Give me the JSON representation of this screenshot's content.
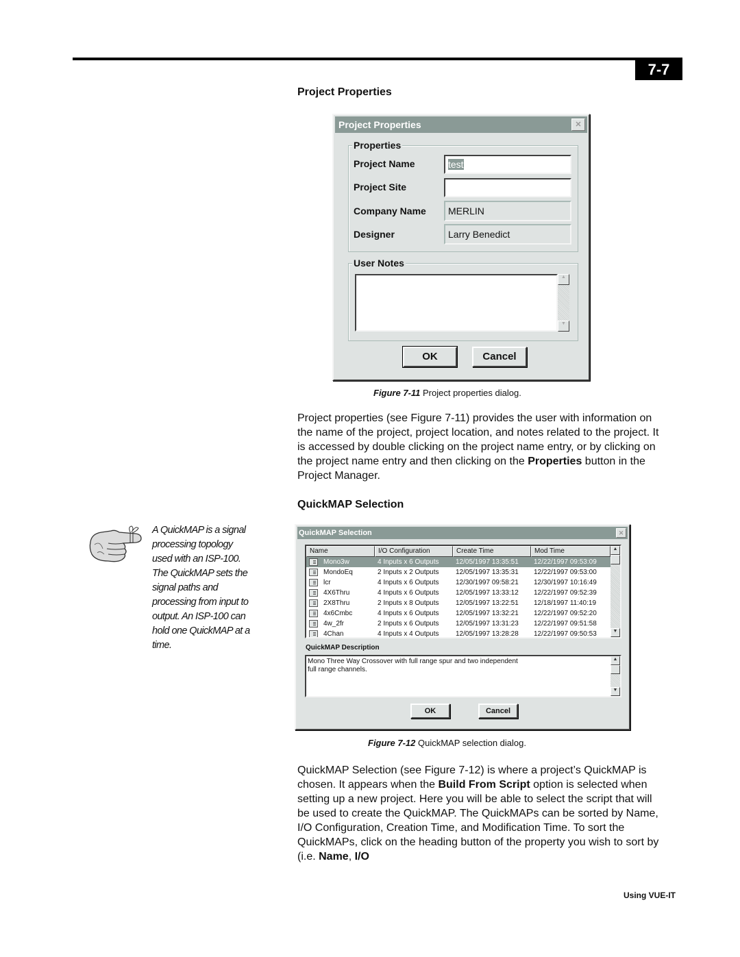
{
  "page": {
    "page_number": "7-7",
    "footer": "Using VUE-IT"
  },
  "section1": {
    "heading": "Project Properties",
    "caption_fig": "Figure 7-11",
    "caption_text": " Project properties dialog.",
    "para_parts": [
      "Project properties (see Figure 7-11) provides the user with information on the name of the project, project location, and notes related to the project. It is accessed by double clicking on the project name entry, or by clicking on the project name entry and then clicking on the ",
      "Properties",
      " button in the Project Manager."
    ]
  },
  "project_dialog": {
    "title": "Project Properties",
    "close_glyph": "✕",
    "properties_group": "Properties",
    "fields": [
      {
        "label": "Project Name",
        "value": "test",
        "editable": true,
        "selected": true
      },
      {
        "label": "Project Site",
        "value": "",
        "editable": true,
        "selected": false
      },
      {
        "label": "Company Name",
        "value": "MERLIN",
        "editable": false,
        "selected": false
      },
      {
        "label": "Designer",
        "value": "Larry Benedict",
        "editable": false,
        "selected": false
      }
    ],
    "notes_group": "User Notes",
    "notes_value": "",
    "ok_label": "OK",
    "cancel_label": "Cancel"
  },
  "section2": {
    "heading": "QuickMAP Selection",
    "caption_fig": "Figure 7-12",
    "caption_text": " QuickMAP selection dialog.",
    "para_parts": [
      "QuickMAP Selection (see Figure 7-12) is where a project’s QuickMAP is chosen.  It appears when the ",
      "Build From Script",
      " option is selected when setting up a new project. Here you will be able to select the script that will be used to create the QuickMAP. The QuickMAPs can be sorted by Name, I/O Configuration, Creation Time, and Modification Time. To sort the QuickMAPs, click on the heading button of the property you wish to sort by (i.e. ",
      "Name",
      ", ",
      "I/O"
    ]
  },
  "sidenote": {
    "icon": "pointing-hand-with-string",
    "text": "A QuickMAP is a signal processing topology used with an ISP-100. The QuickMAP sets the signal paths and processing from input to output. An ISP-100 can hold one QuickMAP at a time."
  },
  "quickmap_dialog": {
    "title": "QuickMAP Selection",
    "close_glyph": "✕",
    "columns": [
      "Name",
      "I/O Configuration",
      "Create Time",
      "Mod Time"
    ],
    "rows": [
      {
        "name": "Mono3w",
        "io": "4 Inputs x 6 Outputs",
        "created": "12/05/1997 13:35:51",
        "modified": "12/22/1997 09:53:09",
        "selected": true
      },
      {
        "name": "MondoEq",
        "io": "2 Inputs x 2 Outputs",
        "created": "12/05/1997 13:35:31",
        "modified": "12/22/1997 09:53:00",
        "selected": false
      },
      {
        "name": "lcr",
        "io": "4 Inputs x 6 Outputs",
        "created": "12/30/1997 09:58:21",
        "modified": "12/30/1997 10:16:49",
        "selected": false
      },
      {
        "name": "4X6Thru",
        "io": "4 Inputs x 6 Outputs",
        "created": "12/05/1997 13:33:12",
        "modified": "12/22/1997 09:52:39",
        "selected": false
      },
      {
        "name": "2X8Thru",
        "io": "2 Inputs x 8 Outputs",
        "created": "12/05/1997 13:22:51",
        "modified": "12/18/1997 11:40:19",
        "selected": false
      },
      {
        "name": "4x6Cmbc",
        "io": "4 Inputs x 6 Outputs",
        "created": "12/05/1997 13:32:21",
        "modified": "12/22/1997 09:52:20",
        "selected": false
      },
      {
        "name": "4w_2fr",
        "io": "2 Inputs x 6 Outputs",
        "created": "12/05/1997 13:31:23",
        "modified": "12/22/1997 09:51:58",
        "selected": false
      },
      {
        "name": "4Chan",
        "io": "4 Inputs x 4 Outputs",
        "created": "12/05/1997 13:28:28",
        "modified": "12/22/1997 09:50:53",
        "selected": false
      }
    ],
    "description_label": "QuickMAP Description",
    "description_text": "Mono Three Way Crossover with full range spur and two independent\nfull range channels.",
    "ok_label": "OK",
    "cancel_label": "Cancel",
    "scroll_up_glyph": "▲",
    "scroll_down_glyph": "▼"
  }
}
